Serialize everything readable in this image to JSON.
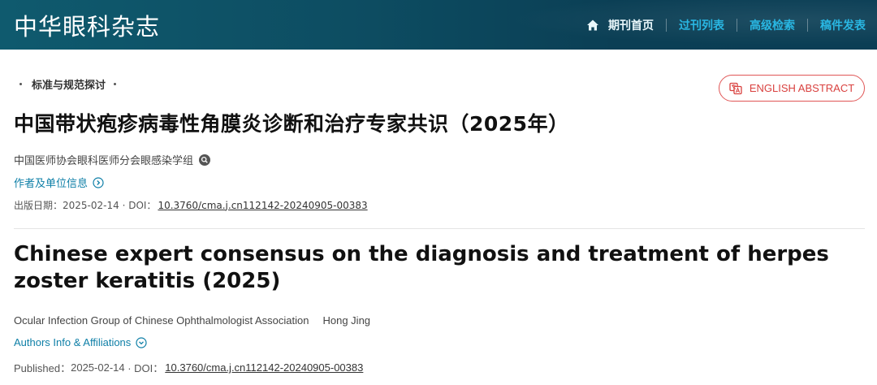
{
  "header": {
    "brand": "中华眼科杂志",
    "nav": [
      {
        "label": "期刊首页",
        "icon": "home-icon",
        "active": true
      },
      {
        "label": "过刊列表"
      },
      {
        "label": "高级检索"
      },
      {
        "label": "稿件发表"
      }
    ]
  },
  "article": {
    "column": "标准与规范探讨",
    "english_abstract_button": "ENGLISH ABSTRACT",
    "cn": {
      "title": "中国带状疱疹病毒性角膜炎诊断和治疗专家共识（2025年）",
      "authors": "中国医师协会眼科医师分会眼感染学组",
      "info_link": "作者及单位信息",
      "pub_label": "出版日期：",
      "pub_date": "2025-02-14",
      "doi_label": " · DOI：",
      "doi": "10.3760/cma.j.cn112142-20240905-00383"
    },
    "en": {
      "title": "Chinese expert consensus on the diagnosis and treatment of herpes zoster keratitis (2025)",
      "authors_group": "Ocular Infection Group of Chinese Ophthalmologist Association",
      "author": "Hong Jing",
      "info_link": "Authors Info & Affiliations",
      "pub_label": "Published：",
      "pub_date": "2025-02-14",
      "doi_label": " · DOI：",
      "doi": "10.3760/cma.j.cn112142-20240905-00383"
    }
  },
  "colors": {
    "header_bg": "#0d4d62",
    "nav_link": "#29b7e3",
    "accent_red": "#d9413f",
    "link_blue": "#0e7fa7"
  }
}
